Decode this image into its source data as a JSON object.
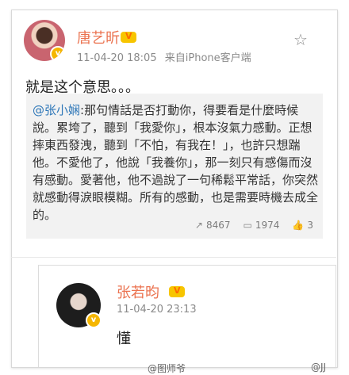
{
  "post": {
    "author": "唐艺昕",
    "time": "11-04-20 18:05",
    "source": "来自iPhone客户端",
    "text": "就是这个意思。。。",
    "repost": {
      "mention": "@张小娴",
      "body": ":那句情話是否打動你，得要看是什麼時候說。累垮了，聽到「我愛你」，根本沒氣力感動。正想摔東西發洩，聽到「不怕，有我在！」，也許只想踹他。不愛他了，他說「我養你」，那一刻只有感傷而沒有感動。愛著他，他不過說了一句稀鬆平常話，你突然就感動得淚眼模糊。所有的感動，也是需要時機去成全的。",
      "shares": "8467",
      "comments": "1974",
      "likes": "3"
    }
  },
  "reply": {
    "author": "张若昀",
    "time": "11-04-20 23:13",
    "text": "懂"
  },
  "watermark": {
    "left": "@图师爷",
    "right": "@JJ"
  },
  "icons": {
    "favorite": "star-icon",
    "share": "share-icon",
    "comment": "comment-icon",
    "like": "thumbs-up-icon",
    "verified": "verified-badge-icon"
  },
  "colors": {
    "name": "#eb7350",
    "mention": "#2e77b8",
    "repost_bg": "#f2f2f2"
  }
}
